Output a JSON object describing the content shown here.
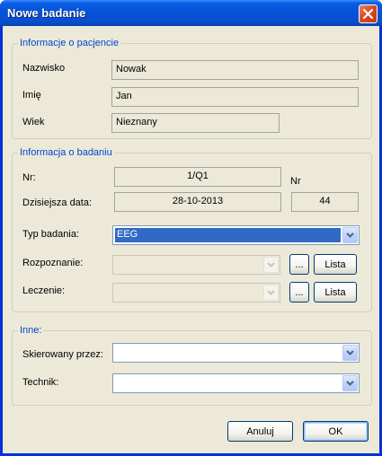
{
  "window": {
    "title": "Nowe badanie"
  },
  "patient_group": {
    "legend": "Informacje o pacjencie",
    "surname_label": "Nazwisko",
    "surname_value": "Nowak",
    "firstname_label": "Imię",
    "firstname_value": "Jan",
    "age_label": "Wiek",
    "age_value": "Nieznany"
  },
  "exam_group": {
    "legend": "Informacja o badaniu",
    "nr_label": "Nr:",
    "nr_value": "1/Q1",
    "nr_right_label": "Nr",
    "date_label": "Dzisiejsza data:",
    "date_value": "28-10-2013",
    "nr_right_value": "44",
    "type_label": "Typ badania:",
    "type_value": "EEG",
    "diagnosis_label": "Rozpoznanie:",
    "treatment_label": "Leczenie:",
    "dots_label": "...",
    "list_label": "Lista"
  },
  "other_group": {
    "legend": "Inne:",
    "referred_label": "Skierowany przez:",
    "technician_label": "Technik:"
  },
  "buttons": {
    "cancel": "Anuluj",
    "ok": "OK"
  },
  "colors": {
    "title_bar": "#0a5fe6",
    "legend_text": "#0046d5",
    "selection": "#316ac5",
    "close_button": "#d9461f"
  }
}
